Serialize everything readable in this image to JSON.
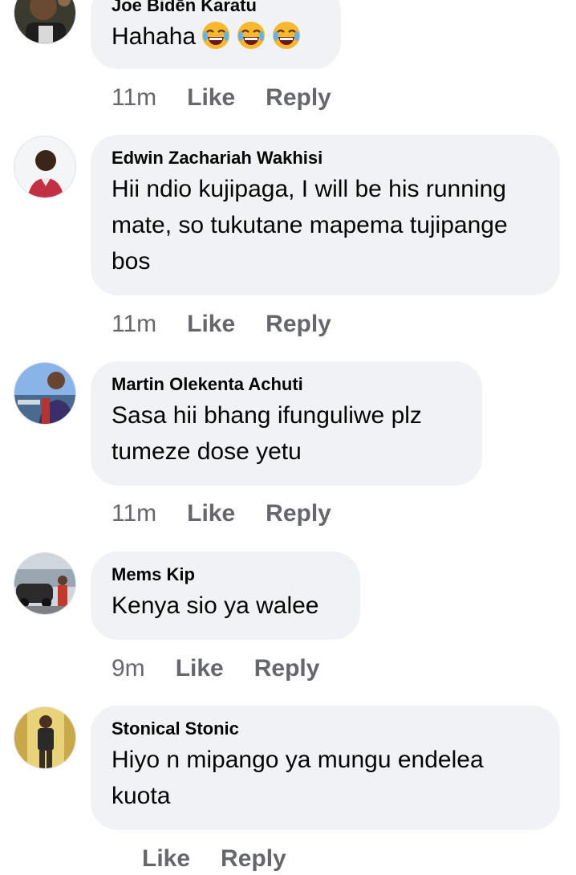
{
  "comments": [
    {
      "author": "Joe Bidēn Karatu",
      "text": "Hahaha",
      "emojis": [
        "joy-emoji",
        "joy-emoji",
        "joy-emoji"
      ],
      "time": "11m",
      "like": "Like",
      "reply": "Reply"
    },
    {
      "author": "Edwin Zachariah Wakhisi",
      "text": "Hii ndio kujipaga, I will be his running mate, so tukutane mapema tujipange bos",
      "time": "11m",
      "like": "Like",
      "reply": "Reply"
    },
    {
      "author": "Martin Olekenta Achuti",
      "text": "Sasa hii bhang ifunguliwe plz tumeze dose yetu",
      "time": "11m",
      "like": "Like",
      "reply": "Reply"
    },
    {
      "author": "Mems Kip",
      "text": "Kenya sio ya walee",
      "time": "9m",
      "like": "Like",
      "reply": "Reply"
    },
    {
      "author": "Stonical Stonic",
      "text": "Hiyo n mipango  ya mungu  endelea kuota",
      "time": "",
      "like": "Like",
      "reply": "Reply"
    }
  ],
  "colors": {
    "bubble": "#f0f2f5",
    "meta": "#65676b",
    "text": "#050505"
  }
}
